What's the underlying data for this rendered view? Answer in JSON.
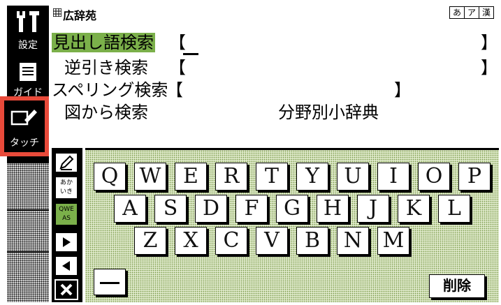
{
  "window": {
    "title": "広辞苑"
  },
  "kana_switch": [
    "あ",
    "ア",
    "漢"
  ],
  "sidebar": {
    "settings_label": "設定",
    "guide_label": "ガイド",
    "touch_label": "タッチ"
  },
  "menu": {
    "headword_search": "見出し語検索",
    "reverse_search": "逆引き検索",
    "spelling_search": "スペリング検索",
    "figure_search": "図から検索",
    "field_dictionary": "分野別小辞典"
  },
  "tools": {
    "aikana_label": "あかいき",
    "qwerty_label": "QWEAS"
  },
  "keyboard": {
    "row1": [
      "Q",
      "W",
      "E",
      "R",
      "T",
      "Y",
      "U",
      "I",
      "O",
      "P"
    ],
    "row2": [
      "A",
      "S",
      "D",
      "F",
      "G",
      "H",
      "J",
      "K",
      "L"
    ],
    "row3": [
      "Z",
      "X",
      "C",
      "V",
      "B",
      "N",
      "M"
    ],
    "delete_label": "削除"
  },
  "colors": {
    "highlight": "#7bb04a",
    "touch_frame": "#e84a3a"
  }
}
